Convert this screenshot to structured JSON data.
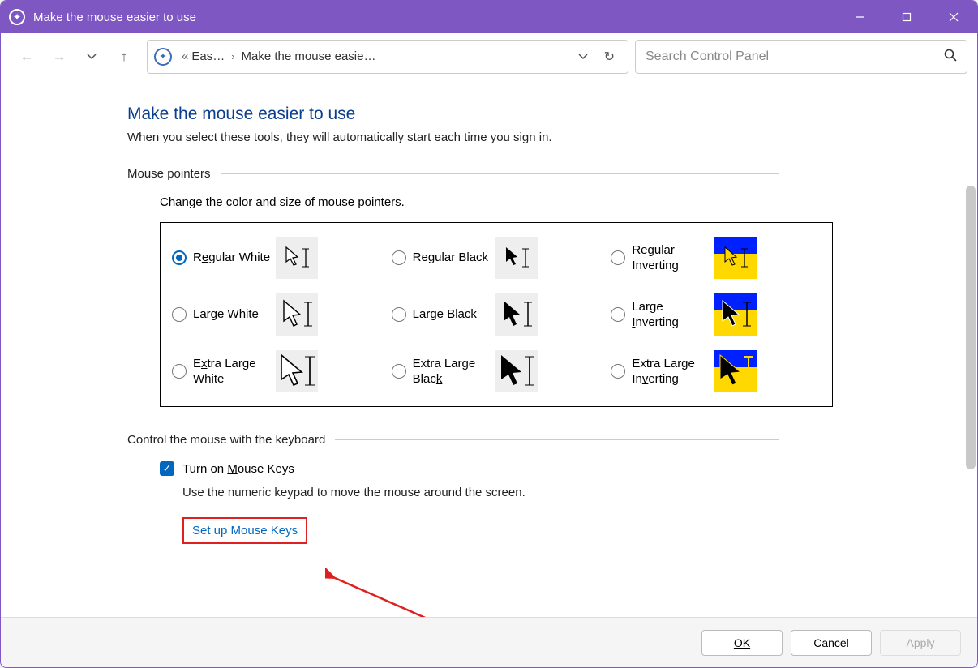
{
  "window": {
    "title": "Make the mouse easier to use"
  },
  "breadcrumb": {
    "item1": "Eas…",
    "item2": "Make the mouse easie…"
  },
  "search": {
    "placeholder": "Search Control Panel"
  },
  "page": {
    "heading": "Make the mouse easier to use",
    "subtitle": "When you select these tools, they will automatically start each time you sign in."
  },
  "sections": {
    "pointers": {
      "title": "Mouse pointers",
      "desc": "Change the color and size of mouse pointers.",
      "options": {
        "regular_white_pre": "R",
        "regular_white_u": "e",
        "regular_white_post": "gular White",
        "regular_black": "Regular Black",
        "regular_inverting": "Regular Inverting",
        "large_white_pre": "",
        "large_white_u": "L",
        "large_white_post": "arge White",
        "large_black_pre": "Large ",
        "large_black_u": "B",
        "large_black_post": "lack",
        "large_inverting_pre": "Large ",
        "large_inverting_u": "I",
        "large_inverting_post": "nverting",
        "xl_white_pre": "E",
        "xl_white_u": "x",
        "xl_white_post": "tra Large White",
        "xl_black_pre": "Extra Large Blac",
        "xl_black_u": "k",
        "xl_black_post": "",
        "xl_inverting_pre": "Extra Large In",
        "xl_inverting_u": "v",
        "xl_inverting_post": "erting"
      }
    },
    "keyboard": {
      "title": "Control the mouse with the keyboard",
      "checkbox_pre": "Turn on ",
      "checkbox_u": "M",
      "checkbox_post": "ouse Keys",
      "desc": "Use the numeric keypad to move the mouse around the screen.",
      "link": "Set up Mouse Keys"
    }
  },
  "buttons": {
    "ok": "OK",
    "cancel": "Cancel",
    "apply": "Apply"
  }
}
